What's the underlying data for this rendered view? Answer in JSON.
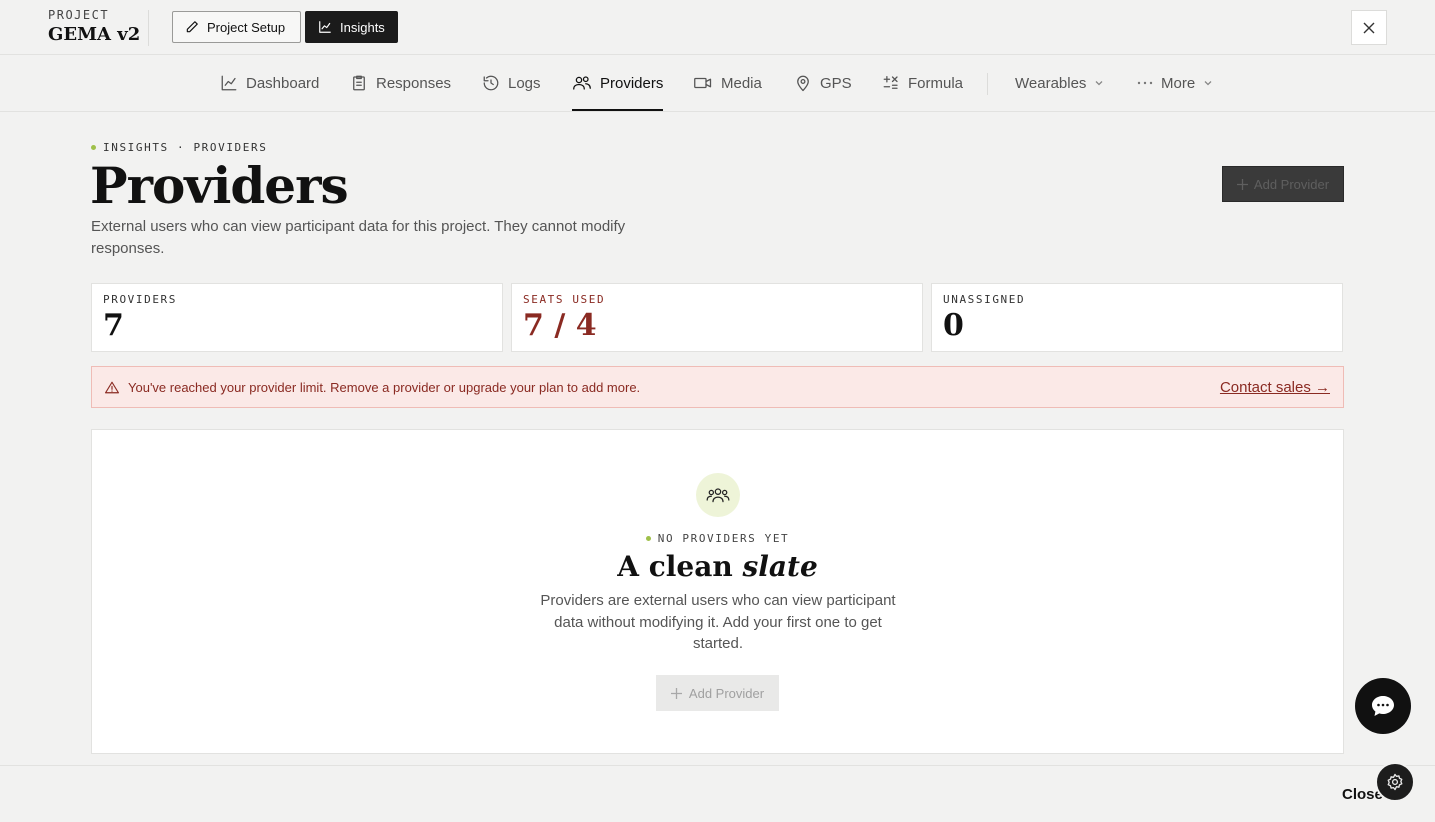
{
  "project": {
    "label": "PROJECT",
    "name": "GEMA v2"
  },
  "topbar": {
    "setup_label": "Project Setup",
    "insights_label": "Insights"
  },
  "tabs": [
    {
      "label": "Dashboard",
      "icon": "chart-line-icon"
    },
    {
      "label": "Responses",
      "icon": "clipboard-icon"
    },
    {
      "label": "Logs",
      "icon": "history-icon"
    },
    {
      "label": "Providers",
      "icon": "users-icon",
      "active": true
    },
    {
      "label": "Media",
      "icon": "video-icon"
    },
    {
      "label": "GPS",
      "icon": "map-pin-icon"
    },
    {
      "label": "Formula",
      "icon": "formula-icon"
    },
    {
      "label": "Wearables",
      "icon": "chevron-down-icon"
    },
    {
      "label": "More",
      "icon": "ellipsis-icon"
    }
  ],
  "header": {
    "breadcrumb": "INSIGHTS · PROVIDERS",
    "title": "Providers",
    "description": "External users who can view participant data for this project. They cannot modify responses.",
    "add_button": "Add Provider"
  },
  "stats": [
    {
      "label": "PROVIDERS",
      "value": "7"
    },
    {
      "label": "SEATS USED",
      "value": "7 / 4"
    },
    {
      "label": "UNASSIGNED",
      "value": "0"
    }
  ],
  "alert": {
    "text": "You've reached your provider limit. Remove a provider or upgrade your plan to add more.",
    "link": "Contact sales →"
  },
  "empty": {
    "label": "NO PROVIDERS YET",
    "title_plain": "A clean ",
    "title_em": "slate",
    "description": "Providers are external users who can view participant data without modifying it. Add your first one to get started.",
    "button": "Add Provider"
  },
  "footer": {
    "close": "Close"
  },
  "colors": {
    "accent": "#9fc04a",
    "warn": "#8a2a22",
    "dark": "#1b1b1b"
  }
}
